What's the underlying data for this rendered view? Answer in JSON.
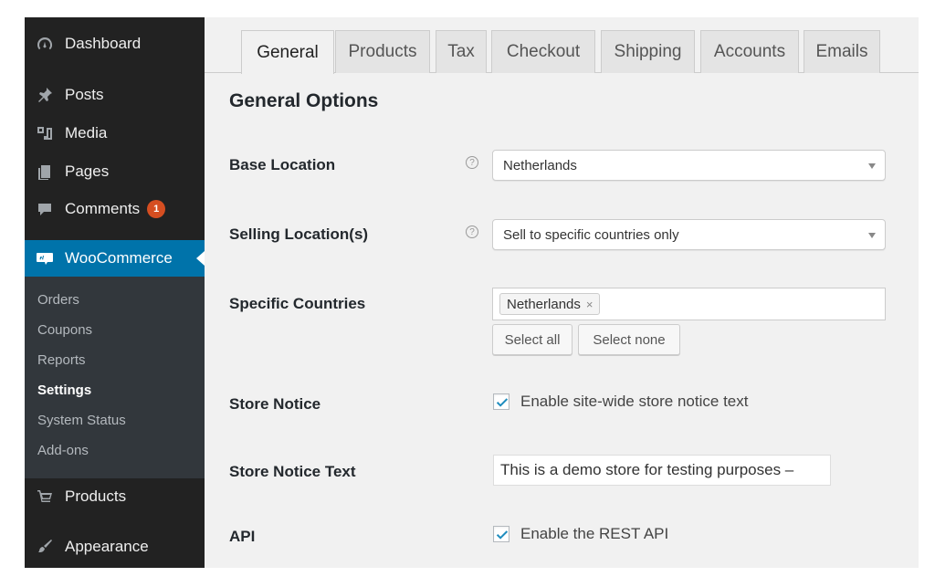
{
  "sidebar": {
    "menu": [
      {
        "label": "Dashboard",
        "icon": "dashboard-icon"
      },
      {
        "label": "Posts",
        "icon": "pushpin-icon"
      },
      {
        "label": "Media",
        "icon": "media-icon"
      },
      {
        "label": "Pages",
        "icon": "pages-icon"
      },
      {
        "label": "Comments",
        "icon": "comment-icon",
        "badge": "1"
      },
      {
        "label": "WooCommerce",
        "icon": "woocommerce-icon"
      },
      {
        "label": "Products",
        "icon": "cart-icon"
      },
      {
        "label": "Appearance",
        "icon": "brush-icon"
      }
    ],
    "submenu": [
      "Orders",
      "Coupons",
      "Reports",
      "Settings",
      "System Status",
      "Add-ons"
    ],
    "current_submenu": "Settings"
  },
  "tabs": [
    "General",
    "Products",
    "Tax",
    "Checkout",
    "Shipping",
    "Accounts",
    "Emails"
  ],
  "active_tab": "General",
  "section_title": "General Options",
  "fields": {
    "base_location": {
      "label": "Base Location",
      "value": "Netherlands",
      "help_icon": "?"
    },
    "selling_locations": {
      "label": "Selling Location(s)",
      "value": "Sell to specific countries only",
      "help_icon": "?"
    },
    "specific_countries": {
      "label": "Specific Countries",
      "chips": [
        "Netherlands"
      ],
      "chip_remove": "×",
      "select_all": "Select all",
      "select_none": "Select none"
    },
    "store_notice": {
      "label": "Store Notice",
      "checkbox_label": "Enable site-wide store notice text",
      "checked": true
    },
    "store_notice_text": {
      "label": "Store Notice Text",
      "value": "This is a demo store for testing purposes –"
    },
    "api": {
      "label": "API",
      "checkbox_label": "Enable the REST API",
      "checked": true
    }
  },
  "colors": {
    "sidebar_bg": "#222222",
    "submenu_bg": "#32373c",
    "accent": "#0073aa",
    "badge": "#d54e21",
    "check": "#1e8cbe"
  }
}
